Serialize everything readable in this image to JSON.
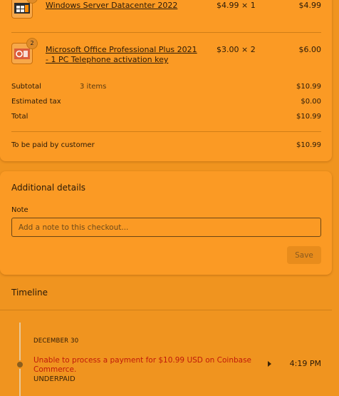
{
  "order": {
    "items": [
      {
        "quantity": "1",
        "name": "Windows Server Datacenter 2022",
        "price": "$4.99 × 1",
        "total": "$4.99",
        "thumb_icon": "windows-server-product-icon"
      },
      {
        "quantity": "2",
        "name": "Microsoft Office Professional Plus 2021 - 1 PC Telephone activation key",
        "price": "$3.00 × 2",
        "total": "$6.00",
        "thumb_icon": "office-product-icon"
      }
    ],
    "summary": {
      "subtotal_label": "Subtotal",
      "subtotal_items": "3 items",
      "subtotal_value": "$10.99",
      "tax_label": "Estimated tax",
      "tax_value": "$0.00",
      "total_label": "Total",
      "total_value": "$10.99",
      "customer_label": "To be paid by customer",
      "customer_value": "$10.99"
    }
  },
  "additional_details": {
    "title": "Additional details",
    "note_label": "Note",
    "note_placeholder": "Add a note to this checkout...",
    "note_value": "",
    "save_label": "Save"
  },
  "timeline": {
    "title": "Timeline",
    "date": "DECEMBER 30",
    "event_message": "Unable to process a payment for $10.99 USD on Coinbase Commerce.",
    "event_status": "UNDERPAID",
    "event_time": "4:19 PM"
  },
  "colors": {
    "background": "#f0941f",
    "card": "#fb9a24",
    "error": "#c01a0a"
  }
}
